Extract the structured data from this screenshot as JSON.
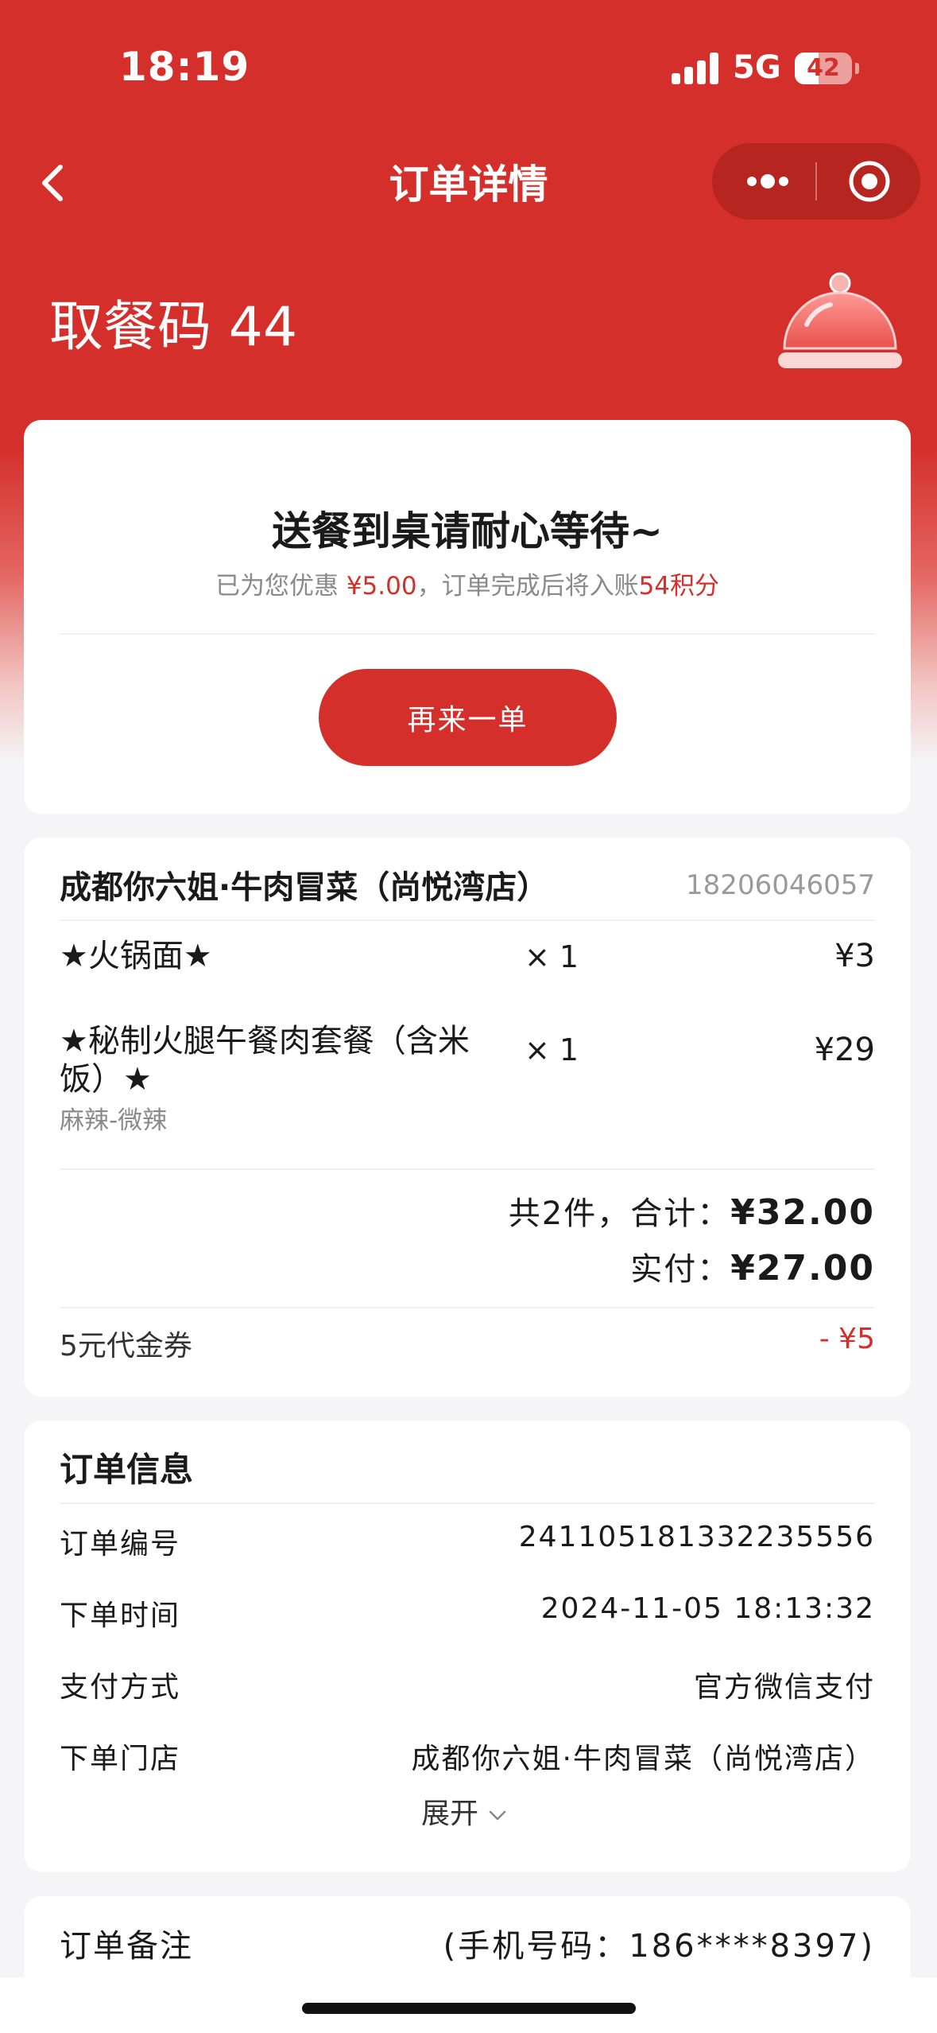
{
  "status_bar": {
    "time": "18:19",
    "network": "5G",
    "battery": "42",
    "battery_fraction": 0.42
  },
  "nav": {
    "title": "订单详情"
  },
  "pickup": {
    "label": "取餐码 44"
  },
  "status_card": {
    "title": "送餐到桌请耐心等待~",
    "sub_prefix": "已为您优惠 ",
    "discount": "¥5.00",
    "sub_middle": "，订单完成后将入账",
    "points": "54积分",
    "reorder_label": "再来一单"
  },
  "order": {
    "store_name": "成都你六姐·牛肉冒菜（尚悦湾店）",
    "store_phone": "18206046057",
    "items": [
      {
        "name": "★火锅面★",
        "qty": "× 1",
        "price": "¥3",
        "spec": ""
      },
      {
        "name": "★秘制火腿午餐肉套餐（含米饭）★",
        "qty": "× 1",
        "price": "¥29",
        "spec": "麻辣-微辣"
      }
    ],
    "total_prefix": "共2件，合计：",
    "total": "¥32.00",
    "paid_prefix": "实付：",
    "paid": "¥27.00",
    "coupon_label": "5元代金券",
    "coupon_value": "- ¥5"
  },
  "info": {
    "title": "订单信息",
    "rows": [
      {
        "label": "订单编号",
        "value": "241105181332235556"
      },
      {
        "label": "下单时间",
        "value": "2024-11-05 18:13:32"
      },
      {
        "label": "支付方式",
        "value": "官方微信支付"
      },
      {
        "label": "下单门店",
        "value": "成都你六姐·牛肉冒菜（尚悦湾店）"
      }
    ],
    "expand_label": "展开"
  },
  "remark": {
    "label": "订单备注",
    "value": "(手机号码：186****8397)"
  },
  "icons": [
    "back-icon",
    "more-icon",
    "miniprogram-close-icon",
    "cloche-icon",
    "chevron-down-icon",
    "signal-icon",
    "battery-icon"
  ],
  "colors": {
    "brand_red": "#d42f2a",
    "muted": "#8a8a8a",
    "background": "#f5f5f7"
  }
}
